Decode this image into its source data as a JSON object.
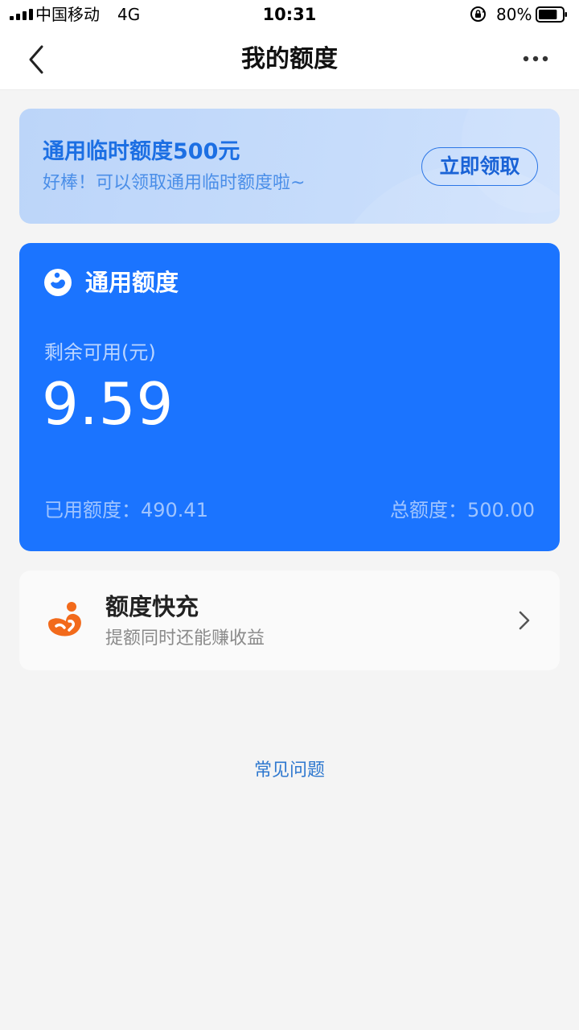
{
  "status_bar": {
    "carrier": "中国移动",
    "network": "4G",
    "time": "10:31",
    "battery_percent": "80%",
    "battery_level": 0.8,
    "icons": [
      "signal-icon",
      "orientation-lock-icon",
      "battery-icon"
    ]
  },
  "nav": {
    "title": "我的额度",
    "icons": [
      "back-arrow-icon",
      "more-options-icon"
    ]
  },
  "promo": {
    "title": "通用临时额度500元",
    "subtitle": "好棒！可以领取通用临时额度啦~",
    "button_label": "立即领取"
  },
  "quota": {
    "title": "通用额度",
    "remaining_label": "剩余可用(元)",
    "remaining_value": "9.59",
    "used_label": "已用额度：490.41",
    "total_label": "总额度：500.00",
    "icons": [
      "quota-logo-icon"
    ]
  },
  "recharge": {
    "title": "额度快充",
    "subtitle": "提额同时还能赚收益",
    "icons": [
      "recharge-icon",
      "chevron-right-icon"
    ]
  },
  "faq": {
    "label": "常见问题"
  },
  "colors": {
    "primary_blue": "#1b74ff",
    "promo_bg": "#c4dafa",
    "promo_text": "#1c6fe3",
    "link": "#2e78cf",
    "recharge_icon": "#f26a1b",
    "page_bg": "#f4f4f4"
  }
}
